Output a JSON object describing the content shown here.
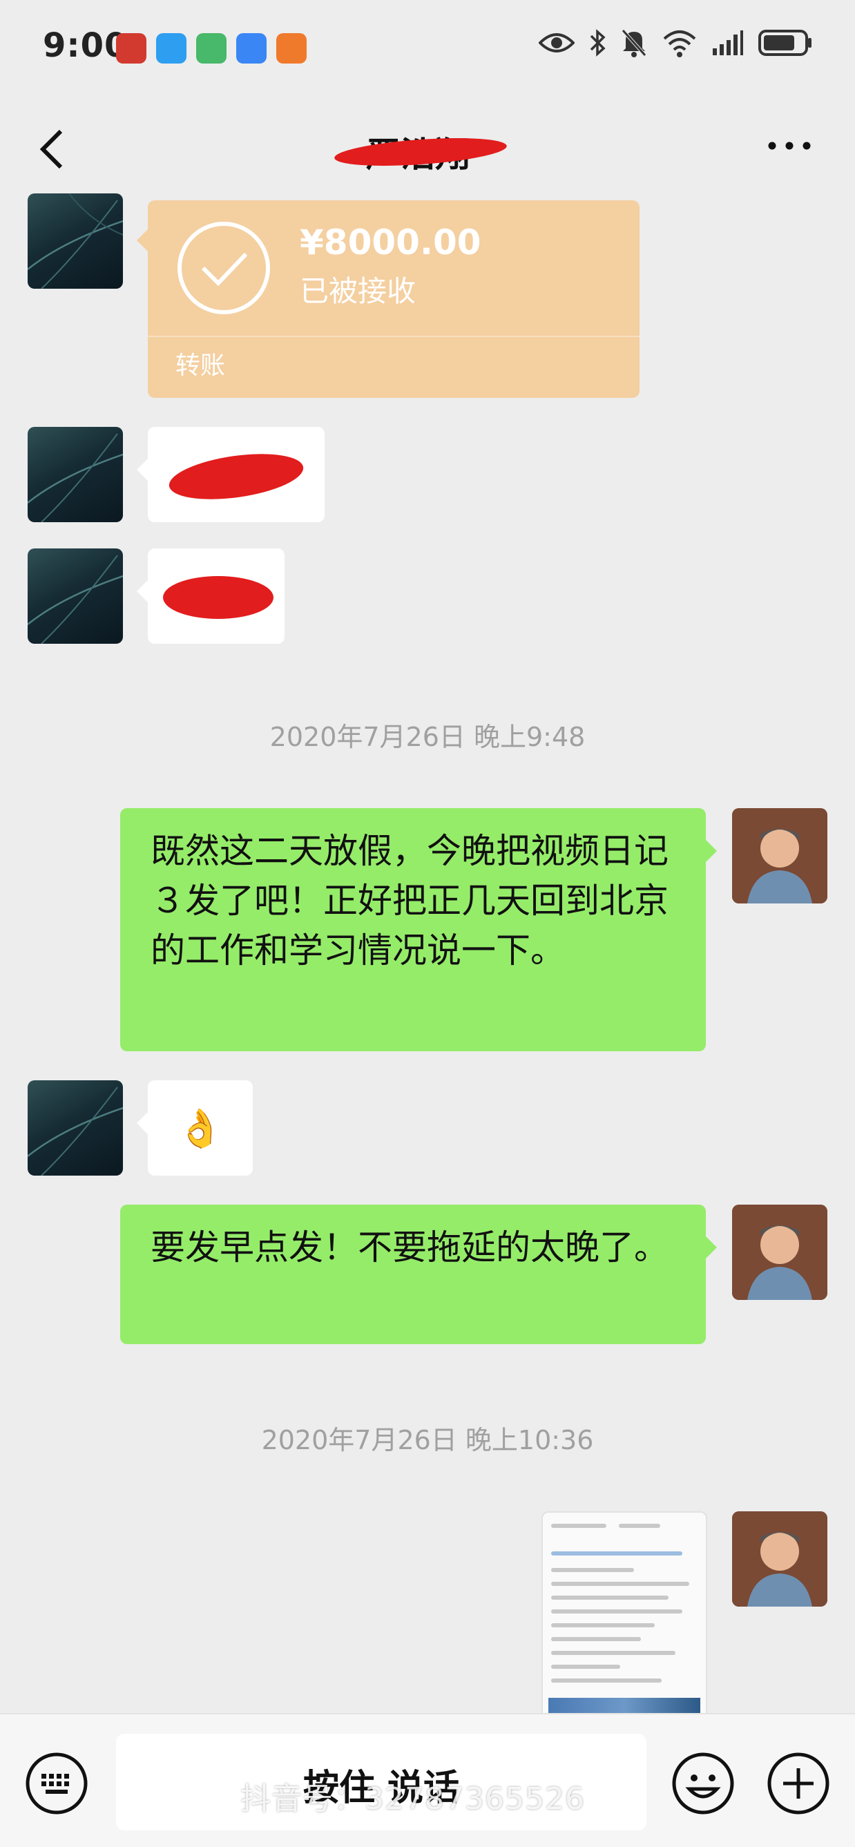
{
  "status_bar": {
    "time": "9:00",
    "app_icons": [
      "bank-app-icon",
      "message-app-icon",
      "health-app-icon",
      "cloud-app-icon",
      "shopping-app-icon"
    ],
    "system_icons": [
      "eye-icon",
      "bluetooth-icon",
      "mute-icon",
      "wifi-icon",
      "signal-icon",
      "battery-icon"
    ]
  },
  "header": {
    "title": "严浩翔",
    "back_icon": "chevron-left-icon",
    "more_icon": "more-dots-icon"
  },
  "messages": {
    "transfer": {
      "amount": "¥8000.00",
      "status": "已被接收",
      "label": "转账"
    },
    "timestamp_1": "2020年7月26日 晚上9:48",
    "msg_1": "既然这二天放假，今晚把视频日记３发了吧！正好把正几天回到北京的工作和学习情况说一下。",
    "reply_1": "👌",
    "msg_2": "要发早点发！不要拖延的太晚了。",
    "timestamp_2": "2020年7月26日 晚上10:36"
  },
  "input_bar": {
    "hold_to_talk": "按住 说话",
    "watermark": "抖音号：32787365526"
  },
  "colors": {
    "background": "#ededed",
    "green_bubble": "#95ec69",
    "transfer_bubble": "#f4cfa0",
    "redaction": "#e21d1d"
  }
}
